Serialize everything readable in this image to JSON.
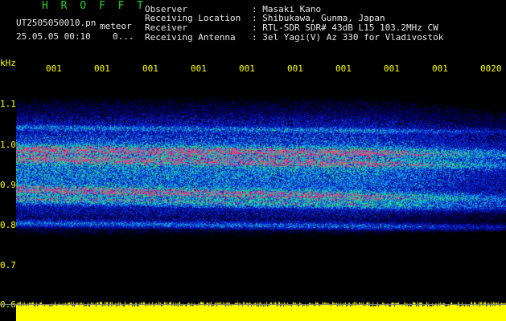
{
  "app": {
    "title": "H R O F F T"
  },
  "file": {
    "name": "UT2505050010.pn",
    "suffix": "meteor",
    "datetime": "25.05.05 00:10",
    "counter": "0..."
  },
  "header": {
    "rows": [
      {
        "label": "Observer",
        "value": ": Masaki Kano"
      },
      {
        "label": "Receiving Location",
        "value": ": Shibukawa, Gunma, Japan"
      },
      {
        "label": "Receiver",
        "value": ": RTL-SDR SDR# 43dB L15 103.2MHz CW"
      },
      {
        "label": "Receiving Antenna",
        "value": ": 3el Yagi(V) Az 330 for Vladivostok"
      }
    ]
  },
  "time_axis": {
    "labels": [
      "001",
      "001",
      "001",
      "001",
      "001",
      "001",
      "001",
      "001",
      "001",
      "0020"
    ]
  },
  "freq_axis": {
    "unit": "kHz",
    "labels": [
      "1.1",
      "1.0",
      "0.9",
      "0.8",
      "0.7",
      "0.6"
    ]
  },
  "colors": {
    "text": "#e8e8e8",
    "axis": "#ffff00",
    "title": "#28d228",
    "background": "#000000",
    "power": "#ffff00"
  }
}
